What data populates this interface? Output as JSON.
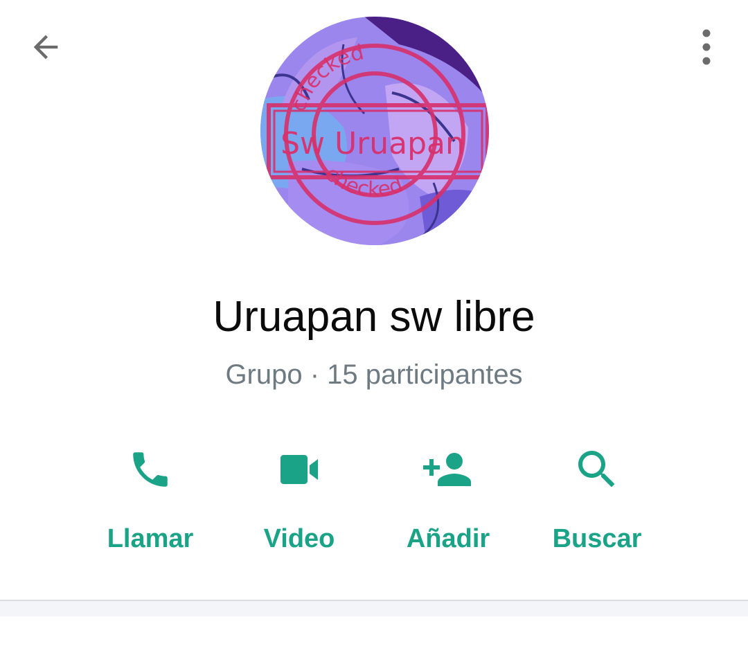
{
  "header": {
    "back_icon": "arrow-left-icon",
    "menu_icon": "more-vertical-icon"
  },
  "avatar": {
    "stamp_text": "Sw Uruapan",
    "stamp_ring_text": "checked",
    "stamp_color": "#d8306b"
  },
  "group": {
    "name": "Uruapan sw libre",
    "subtitle": "Grupo · 15 participantes"
  },
  "actions": [
    {
      "label": "Llamar",
      "icon": "phone-icon"
    },
    {
      "label": "Video",
      "icon": "video-camera-icon"
    },
    {
      "label": "Añadir",
      "icon": "add-person-icon"
    },
    {
      "label": "Buscar",
      "icon": "search-icon"
    }
  ],
  "colors": {
    "accent": "#1aa386",
    "icon_gray": "#6b6b6b",
    "subtitle_gray": "#6e7a81"
  }
}
